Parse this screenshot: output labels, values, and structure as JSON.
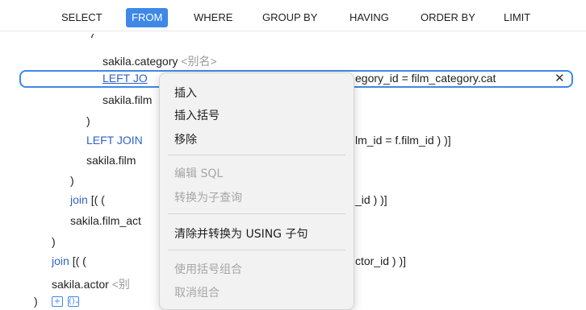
{
  "tabs": [
    "SELECT",
    "FROM",
    "WHERE",
    "GROUP BY",
    "HAVING",
    "ORDER BY",
    "LIMIT"
  ],
  "active_tab": "FROM",
  "code_lines": {
    "l0": "(",
    "l1_table": "sakila.category",
    "l1_alias": "<别名>",
    "l2_kw": "LEFT JO",
    "l2_tail": "egory_id = film_category.cat",
    "l3": "sakila.film",
    "l4": ")",
    "l5_kw": "LEFT JOIN",
    "l5_tail": "lm_id = f.film_id  ) )]",
    "l6": "sakila.film",
    "l7": ")",
    "l8_kw": "join",
    "l8_mid": "[(    (",
    "l8_tail": "_id       ) )]",
    "l9": "sakila.film_act",
    "l10": ")",
    "l11_kw": "join",
    "l11_mid": "[(    (",
    "l11_tail": "ctor_id  ) )]",
    "l12_table": "sakila.actor",
    "l12_alias": "<别",
    "l13": ")"
  },
  "close_symbol": "✕",
  "mini_buttons": [
    "+",
    "()₊"
  ],
  "context_menu": {
    "insert": "插入",
    "insert_paren": "插入括号",
    "remove": "移除",
    "edit_sql": "编辑 SQL",
    "to_subquery": "转换为子查询",
    "clear_to_using": "清除并转换为 USING 子句",
    "group_with_paren": "使用括号组合",
    "ungroup": "取消组合"
  },
  "colors": {
    "accent": "#3e88e6",
    "keyword": "#2f62c8",
    "placeholder": "#9a9a9a"
  }
}
